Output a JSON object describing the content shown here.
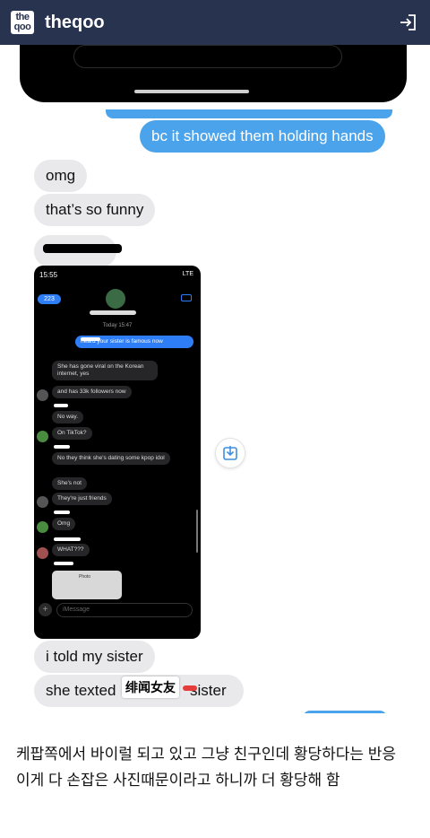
{
  "header": {
    "logo_top": "the",
    "logo_bottom": "qoo",
    "site_name": "theqoo",
    "login_icon": "login-arrow-icon"
  },
  "messages": {
    "outgoing_1": "bc it showed them holding hands",
    "incoming_1": "omg",
    "incoming_2": "that’s so funny",
    "incoming_3": "i told my sister",
    "incoming_4_before": "she texted",
    "incoming_4_after": "sister"
  },
  "sticker_text": "绯闻女友",
  "embedded_phone": {
    "status_time": "15:55",
    "status_signal": "LTE",
    "back_count": "223",
    "timestamp": "Today 15:47",
    "input_placeholder": "iMessage",
    "photo_label": "Photo",
    "bubbles": [
      {
        "dir": "out",
        "text": "heard your sister is famous now"
      },
      {
        "dir": "in",
        "text": "She has gone viral on the Korean internet, yes"
      },
      {
        "dir": "in",
        "text": "and has 33k followers now"
      },
      {
        "dir": "in",
        "text": "No way."
      },
      {
        "dir": "in",
        "text": "On TikTok?"
      },
      {
        "dir": "in",
        "text": "No they think she's dating some kpop idol"
      },
      {
        "dir": "in",
        "text": "She's not"
      },
      {
        "dir": "in",
        "text": "They're just friends"
      },
      {
        "dir": "in",
        "text": "Omg"
      },
      {
        "dir": "in",
        "text": "WHAT???"
      }
    ]
  },
  "caption": {
    "line1": "케팝쪽에서 바이럴 되고 있고 그냥 친구인데 황당하다는 반응",
    "line2": "이게 다 손잡은 사진때문이라고 하니까 더 황당해 함"
  },
  "colors": {
    "header_bg": "#283350",
    "bubble_blue": "#4ba3ec",
    "bubble_gray": "#e9e9eb"
  }
}
